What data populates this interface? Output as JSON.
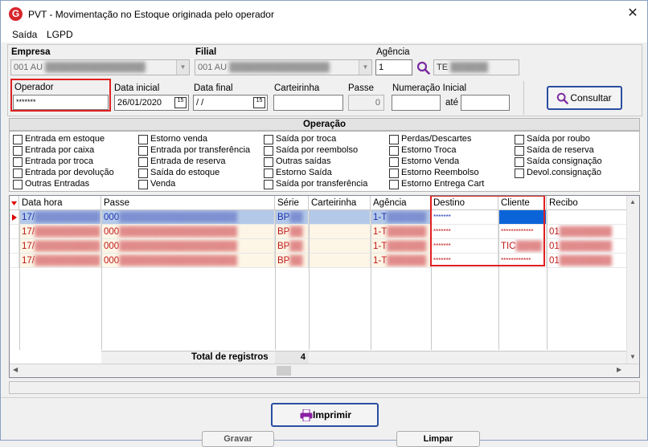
{
  "window": {
    "title": "PVT - Movimentação no Estoque originada pelo operador",
    "close": "✕",
    "app_icon": "G"
  },
  "menu": {
    "items": [
      "Saída",
      "LGPD"
    ]
  },
  "filters": {
    "empresa_label": "Empresa",
    "empresa_value": "001 AU",
    "filial_label": "Filial",
    "filial_value": "001 AU",
    "agencia_label": "Agência",
    "agencia_value": "1",
    "agencia_name": "TE",
    "operador_label": "Operador",
    "operador_value": "*******",
    "data_inicial_label": "Data inicial",
    "data_inicial_value": "26/01/2020",
    "data_final_label": "Data final",
    "data_final_value": " / /",
    "carteirinha_label": "Carteirinha",
    "carteirinha_value": "",
    "passe_label": "Passe",
    "passe_value": "0",
    "numeracao_label": "Numeração Inicial",
    "numeracao_value": "",
    "ate_label": "até",
    "ate_value": "",
    "consultar_label": "Consultar"
  },
  "operacao": {
    "title": "Operação",
    "options": [
      [
        "Entrada em estoque",
        "Entrada por caixa",
        "Entrada por troca",
        "Entrada por devolução",
        "Outras Entradas"
      ],
      [
        "Estorno venda",
        "Entrada por transferência",
        "Entrada de reserva",
        "Saída do estoque",
        "Venda"
      ],
      [
        "Saída por troca",
        "Saída por reembolso",
        "Outras saídas",
        "Estorno Saída",
        "Saída por transferência"
      ],
      [
        "Perdas/Descartes",
        "Estorno Troca",
        "Estorno Venda",
        "Estorno Reembolso",
        "Estorno Entrega Cart"
      ],
      [
        "Saída por roubo",
        "Saída de reserva",
        "Saída consignação",
        "Devol.consignação"
      ]
    ]
  },
  "grid": {
    "columns": [
      "Data hora",
      "Passe",
      "Série",
      "Carteirinha",
      "Agência",
      "Destino",
      "Cliente",
      "Recibo"
    ],
    "rows": [
      {
        "data_hora": "17/",
        "passe": "000",
        "serie": "BP",
        "carteirinha": "",
        "agencia": "1-T",
        "destino": "*******",
        "cliente": "",
        "recibo": ""
      },
      {
        "data_hora": "17/",
        "passe": "000",
        "serie": "BP",
        "carteirinha": "",
        "agencia": "1-T",
        "destino": "*******",
        "cliente": "*************",
        "recibo": "01"
      },
      {
        "data_hora": "17/",
        "passe": "000",
        "serie": "BP",
        "carteirinha": "",
        "agencia": "1-T",
        "destino": "*******",
        "cliente": "TIC",
        "recibo": "01"
      },
      {
        "data_hora": "17/",
        "passe": "000",
        "serie": "BP",
        "carteirinha": "",
        "agencia": "1-T",
        "destino": "*******",
        "cliente": "************",
        "recibo": "01"
      }
    ],
    "total_label": "Total de registros",
    "total_value": "4"
  },
  "footer": {
    "imprimir_label": "Imprimir",
    "gravar_label": "Gravar",
    "limpar_label": "Limpar"
  }
}
